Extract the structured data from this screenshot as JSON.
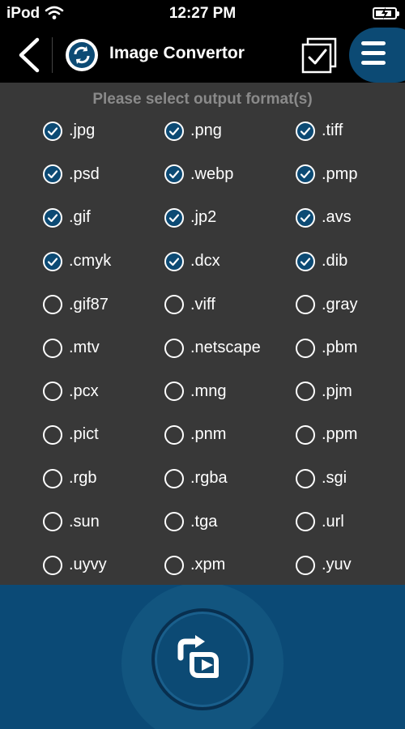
{
  "status_bar": {
    "device": "iPod",
    "time": "12:27 PM",
    "battery_level": 0.85,
    "charging": true
  },
  "nav": {
    "title": "Image Convertor",
    "icons": {
      "back": "chevron-left-icon",
      "app": "refresh-icon",
      "select_all": "checkbox-icon",
      "menu": "hamburger-menu-icon"
    }
  },
  "prompt": "Please select output format(s)",
  "formats": [
    {
      "label": ".jpg",
      "checked": true
    },
    {
      "label": ".png",
      "checked": true
    },
    {
      "label": ".tiff",
      "checked": true
    },
    {
      "label": ".psd",
      "checked": true
    },
    {
      "label": ".webp",
      "checked": true
    },
    {
      "label": ".pmp",
      "checked": true
    },
    {
      "label": ".gif",
      "checked": true
    },
    {
      "label": ".jp2",
      "checked": true
    },
    {
      "label": ".avs",
      "checked": true
    },
    {
      "label": ".cmyk",
      "checked": true
    },
    {
      "label": ".dcx",
      "checked": true
    },
    {
      "label": ".dib",
      "checked": true
    },
    {
      "label": ".gif87",
      "checked": false
    },
    {
      "label": ".viff",
      "checked": false
    },
    {
      "label": ".gray",
      "checked": false
    },
    {
      "label": ".mtv",
      "checked": false
    },
    {
      "label": ".netscape",
      "checked": false
    },
    {
      "label": ".pbm",
      "checked": false
    },
    {
      "label": ".pcx",
      "checked": false
    },
    {
      "label": ".mng",
      "checked": false
    },
    {
      "label": ".pjm",
      "checked": false
    },
    {
      "label": ".pict",
      "checked": false
    },
    {
      "label": ".pnm",
      "checked": false
    },
    {
      "label": ".ppm",
      "checked": false
    },
    {
      "label": ".rgb",
      "checked": false
    },
    {
      "label": ".rgba",
      "checked": false
    },
    {
      "label": ".sgi",
      "checked": false
    },
    {
      "label": ".sun",
      "checked": false
    },
    {
      "label": ".tga",
      "checked": false
    },
    {
      "label": ".url",
      "checked": false
    },
    {
      "label": ".uyvy",
      "checked": false
    },
    {
      "label": ".xpm",
      "checked": false
    },
    {
      "label": ".yuv",
      "checked": false
    }
  ],
  "footer": {
    "convert_icon": "convert-arrows-icon"
  },
  "colors": {
    "accent": "#0c4a74",
    "content_bg": "#383838",
    "prompt_text": "#8a8a8a"
  }
}
